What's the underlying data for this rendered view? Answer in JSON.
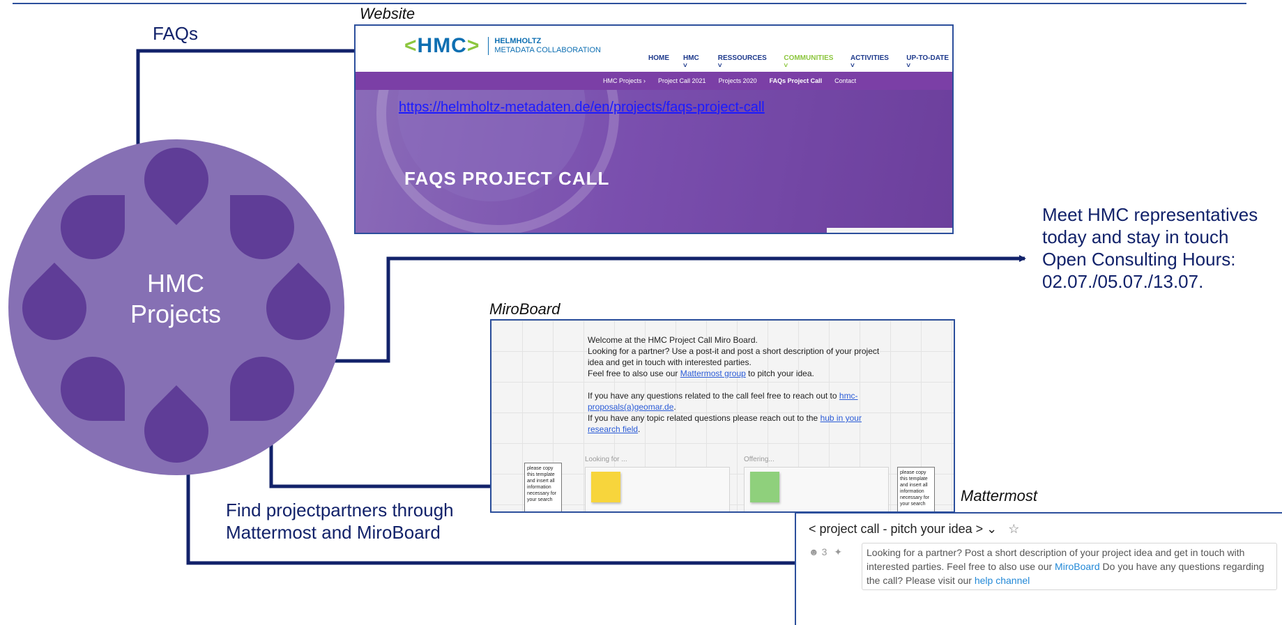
{
  "labels": {
    "faqs": "FAQs",
    "website": "Website",
    "miroboard": "MiroBoard",
    "mattermost": "Mattermost",
    "meet_lines": [
      "Meet HMC representatives",
      "today and stay in touch",
      "Open Consulting Hours:",
      "02.07./05.07./13.07."
    ],
    "find_lines": [
      "Find projectpartners through",
      "Mattermost and MiroBoard"
    ]
  },
  "circle": {
    "title_line1": "HMC",
    "title_line2": "Projects"
  },
  "website": {
    "logo_mark": "HMC",
    "logo_line1": "HELMHOLTZ",
    "logo_line2": "METADATA COLLABORATION",
    "nav": [
      "HOME",
      "HMC ˅",
      "RESSOURCES ˅",
      "COMMUNITIES ˅",
      "ACTIVITIES ˅",
      "UP-TO-DATE ˅"
    ],
    "subnav": [
      "HMC Projects ›",
      "Project Call 2021",
      "Projects 2020",
      "FAQs Project Call",
      "Contact"
    ],
    "url": "https://helmholtz-metadaten.de/en/projects/faqs-project-call",
    "hero_title": "FAQS PROJECT CALL"
  },
  "miro": {
    "welcome": "Welcome at the HMC Project Call Miro Board.",
    "line2": "Looking for a partner? Use a post-it and post a short description of your project idea and get in touch with interested parties.",
    "line3_pre": "Feel free to also use our ",
    "line3_link": "Mattermost group",
    "line3_post": " to pitch your idea.",
    "line4_pre": "If you have any questions related to the call feel free to reach out to ",
    "line4_link": "hmc-proposals(a)geomar.de",
    "line4_post": ".",
    "line5_pre": "If you have any topic related questions please reach out to the ",
    "line5_link": "hub in your research field",
    "line5_post": ".",
    "looking_for": "Looking for ...",
    "offering": "Offering...",
    "template_text": "please copy this template and insert all information necessary for your search"
  },
  "mattermost": {
    "channel": "< project call - pitch your idea > ⌄",
    "members": "3",
    "desc_part1": "Looking for a partner? Post a short description of your project idea and get in touch with interested parties. Feel free to also use our ",
    "desc_link1": "MiroBoard",
    "desc_part2": " Do you have any questions regarding the call? Please visit our ",
    "desc_link2": "help channel"
  },
  "colors": {
    "arrow": "#12226a",
    "circle": "#8670b4",
    "drop": "#5f3d97",
    "purple_bar": "#7b3fa6",
    "frame_border": "#2c4f9c"
  }
}
